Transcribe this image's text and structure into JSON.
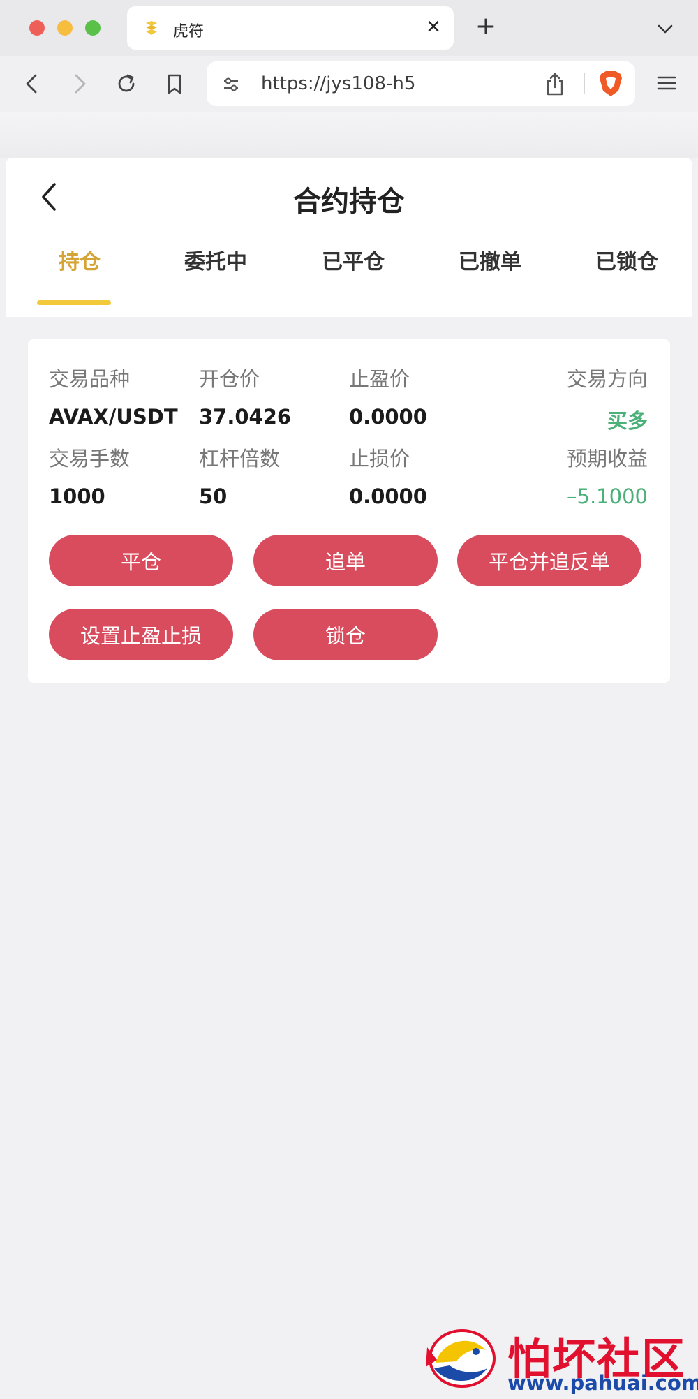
{
  "browser": {
    "tab_title": "虎符",
    "tab_close": "✕",
    "new_tab": "+",
    "url": "https://jys108-h5",
    "icons": [
      "tiger-favicon-icon",
      "back-arrow-icon",
      "forward-arrow-icon",
      "reload-icon",
      "bookmark-icon",
      "site-settings-icon",
      "share-icon",
      "brave-shield-icon",
      "hamburger-menu-icon",
      "chevron-down-icon"
    ]
  },
  "page": {
    "title": "合约持仓",
    "tabs": [
      {
        "label": "持仓",
        "active": true
      },
      {
        "label": "委托中",
        "active": false
      },
      {
        "label": "已平仓",
        "active": false
      },
      {
        "label": "已撤单",
        "active": false
      },
      {
        "label": "已锁仓",
        "active": false
      }
    ],
    "accent_color": "#f2c93a"
  },
  "position": {
    "symbol_label": "交易品种",
    "symbol": "AVAX/USDT",
    "open_price_label": "开仓价",
    "open_price": "37.0426",
    "take_profit_label": "止盈价",
    "take_profit": "0.0000",
    "direction_label": "交易方向",
    "direction": "买多",
    "lots_label": "交易手数",
    "lots": "1000",
    "leverage_label": "杠杆倍数",
    "leverage": "50",
    "stop_loss_label": "止损价",
    "stop_loss": "0.0000",
    "expected_pnl_label": "预期收益",
    "expected_pnl": "–5.1000",
    "positive_color": "#4cb07a"
  },
  "actions": {
    "close": "平仓",
    "chase": "追单",
    "close_and_reverse": "平仓并追反单",
    "set_tp_sl": "设置止盈止损",
    "lock": "锁仓",
    "button_color": "#d84c5e"
  },
  "watermark": {
    "title": "怕坏社区",
    "url": "www.pahuai.com"
  }
}
